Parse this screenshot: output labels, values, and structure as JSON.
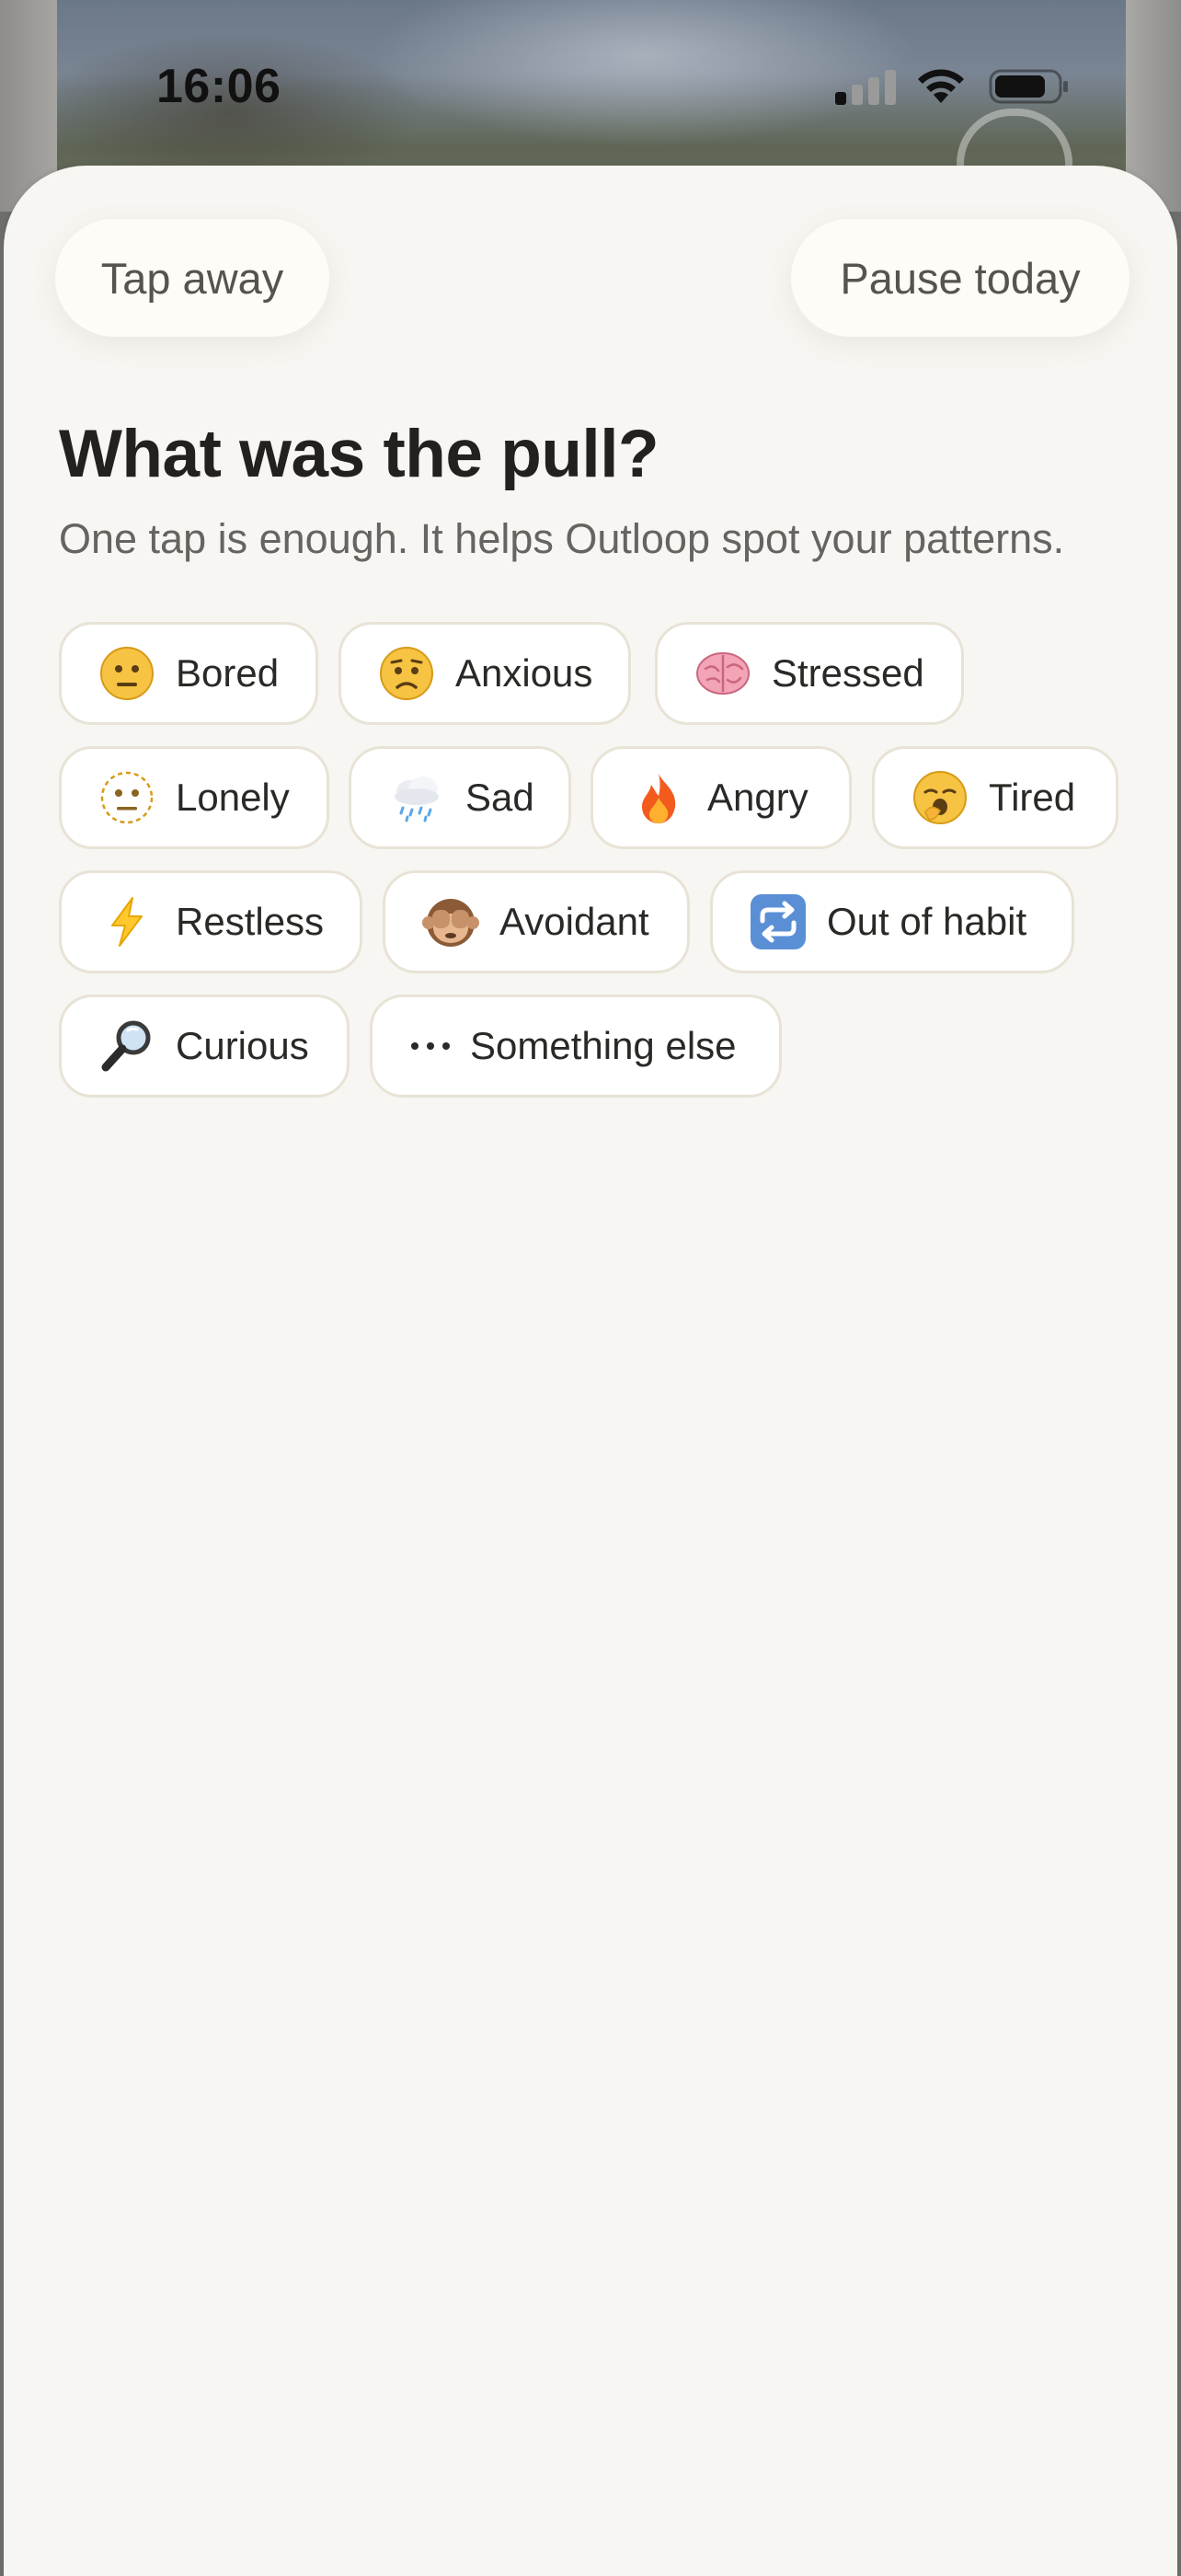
{
  "status_bar": {
    "time": "16:06",
    "signal_bars_active": 1,
    "signal_bars_total": 4
  },
  "sheet": {
    "tap_away_label": "Tap away",
    "pause_today_label": "Pause today",
    "title": "What was the pull?",
    "subtitle": "One tap is enough. It helps Outloop spot your patterns."
  },
  "chips": [
    {
      "label": "Bored",
      "icon": "neutral-face-icon"
    },
    {
      "label": "Anxious",
      "icon": "worried-face-icon"
    },
    {
      "label": "Stressed",
      "icon": "brain-icon"
    },
    {
      "label": "Lonely",
      "icon": "dotted-line-face-icon"
    },
    {
      "label": "Sad",
      "icon": "cloud-with-rain-icon"
    },
    {
      "label": "Angry",
      "icon": "fire-icon"
    },
    {
      "label": "Tired",
      "icon": "yawning-face-icon"
    },
    {
      "label": "Restless",
      "icon": "lightning-icon"
    },
    {
      "label": "Avoidant",
      "icon": "see-no-evil-monkey-icon"
    },
    {
      "label": "Out of habit",
      "icon": "repeat-icon"
    },
    {
      "label": "Curious",
      "icon": "magnifying-glass-icon"
    },
    {
      "label": "Something else",
      "icon": "ellipsis-icon"
    }
  ],
  "colors": {
    "sheet_background": "#f7f6f2",
    "chip_border": "#e8e3d6",
    "title_text": "#222120",
    "subtitle_text": "#666460"
  }
}
